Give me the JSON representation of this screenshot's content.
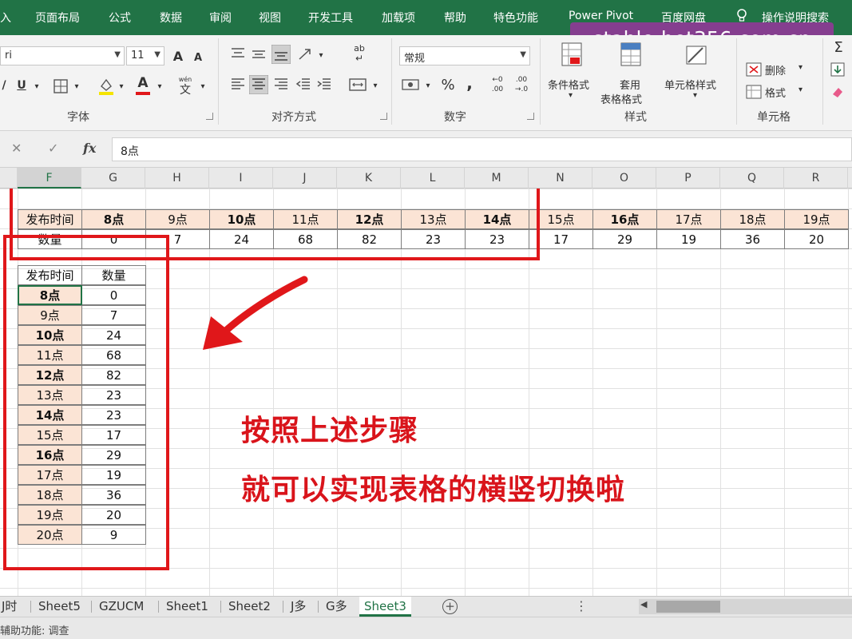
{
  "menu": [
    "入",
    "页面布局",
    "公式",
    "数据",
    "审阅",
    "视图",
    "开发工具",
    "加载项",
    "帮助",
    "特色功能",
    "Power Pivot",
    "百度网盘",
    "操作说明搜索"
  ],
  "watermark": "stable-bet356.com.cn",
  "ribbon": {
    "font_name": "ri",
    "font_size": "11",
    "font_group": "字体",
    "align_group": "对齐方式",
    "number_format": "常规",
    "number_group": "数字",
    "cond_format": "条件格式",
    "table_format_1": "套用",
    "table_format_2": "表格格式",
    "cell_style": "单元格样式",
    "style_group": "样式",
    "delete": "删除",
    "format": "格式",
    "cells_group": "单元格",
    "underline": "U",
    "font_color": "A",
    "grow_font": "A",
    "shrink_font": "A",
    "percent": "%",
    "comma": ",",
    "wen": "wén",
    "wen2": "文",
    "ab": "ab",
    "inc_dec_1": "←0",
    "inc_dec_2": ".00",
    "dec_dec_1": ".00",
    "dec_dec_2": "→.0",
    "sigma": "Σ"
  },
  "formula_bar": {
    "cancel": "✕",
    "enter": "✓",
    "fx": "fx",
    "value": "8点"
  },
  "columns": [
    "F",
    "G",
    "H",
    "I",
    "J",
    "K",
    "L",
    "M",
    "N",
    "O",
    "P",
    "Q",
    "R"
  ],
  "horizontal_table": {
    "row_label_1": "发布时间",
    "row_label_2": "数量",
    "hours": [
      "8点",
      "9点",
      "10点",
      "11点",
      "12点",
      "13点",
      "14点",
      "15点",
      "16点",
      "17点",
      "18点",
      "19点"
    ],
    "counts": [
      "0",
      "7",
      "24",
      "68",
      "82",
      "23",
      "23",
      "17",
      "29",
      "19",
      "36",
      "20"
    ]
  },
  "vertical_table": {
    "header_time": "发布时间",
    "header_count": "数量",
    "rows": [
      {
        "hour": "8点",
        "count": "0"
      },
      {
        "hour": "9点",
        "count": "7"
      },
      {
        "hour": "10点",
        "count": "24"
      },
      {
        "hour": "11点",
        "count": "68"
      },
      {
        "hour": "12点",
        "count": "82"
      },
      {
        "hour": "13点",
        "count": "23"
      },
      {
        "hour": "14点",
        "count": "23"
      },
      {
        "hour": "15点",
        "count": "17"
      },
      {
        "hour": "16点",
        "count": "29"
      },
      {
        "hour": "17点",
        "count": "19"
      },
      {
        "hour": "18点",
        "count": "36"
      },
      {
        "hour": "19点",
        "count": "20"
      },
      {
        "hour": "20点",
        "count": "9"
      }
    ]
  },
  "overlay": {
    "line1": "按照上述步骤",
    "line2": "就可以实现表格的横竖切换啦"
  },
  "sheets": [
    "J时",
    "Sheet5",
    "GZUCM",
    "Sheet1",
    "Sheet2",
    "J多",
    "G多",
    "Sheet3"
  ],
  "active_sheet": "Sheet3",
  "add_sheet": "+",
  "status": "辅助功能: 调查",
  "colors": {
    "excel_green": "#217346",
    "highlight_red": "#e0171a",
    "pink_fill": "#fbe4d5",
    "watermark_purple": "#9b32a0"
  }
}
